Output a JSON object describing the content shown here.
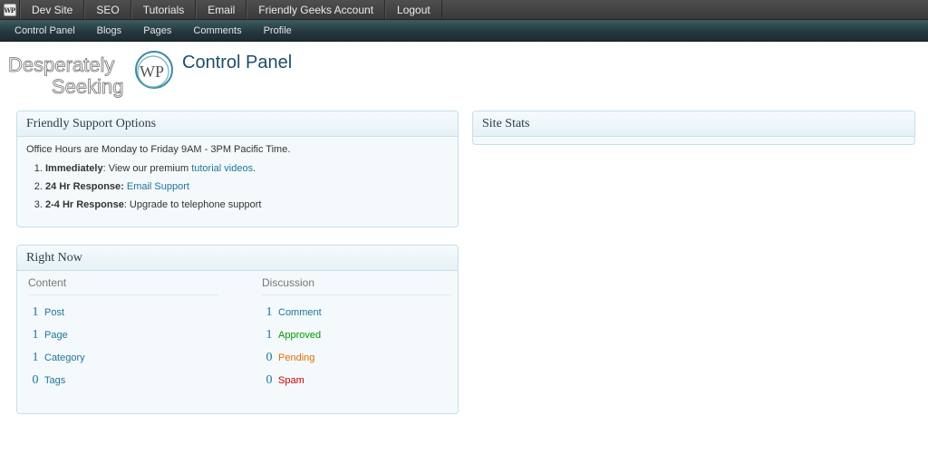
{
  "adminbar": {
    "logo_text": "WP",
    "items": [
      "Dev Site",
      "SEO",
      "Tutorials",
      "Email",
      "Friendly Geeks Account",
      "Logout"
    ]
  },
  "subnav": {
    "items": [
      "Control Panel",
      "Blogs",
      "Pages",
      "Comments",
      "Profile"
    ]
  },
  "header": {
    "logo": {
      "line1": "Desperately",
      "line2": "Seeking",
      "badge": "WP"
    },
    "title": "Control Panel"
  },
  "support": {
    "title": "Friendly Support Options",
    "hours": "Office Hours are Monday to Friday 9AM - 3PM Pacific Time.",
    "options": [
      {
        "num": "1.",
        "bold": "Immediately",
        "text": ": View our premium ",
        "link": "tutorial videos",
        "after": "."
      },
      {
        "num": "2.",
        "bold": "24 Hr Response:",
        "text": " ",
        "link": "Email Support",
        "after": ""
      },
      {
        "num": "3.",
        "bold": "2-4 Hr Response",
        "text": ": Upgrade to telephone support",
        "link": "",
        "after": ""
      }
    ]
  },
  "right_now": {
    "title": "Right Now",
    "content": {
      "heading": "Content",
      "rows": [
        {
          "count": "1",
          "label": "Post"
        },
        {
          "count": "1",
          "label": "Page"
        },
        {
          "count": "1",
          "label": "Category"
        },
        {
          "count": "0",
          "label": "Tags"
        }
      ]
    },
    "discussion": {
      "heading": "Discussion",
      "rows": [
        {
          "count": "1",
          "label": "Comment"
        },
        {
          "count": "1",
          "label": "Approved"
        },
        {
          "count": "0",
          "label": "Pending"
        },
        {
          "count": "0",
          "label": "Spam"
        }
      ]
    }
  },
  "site_stats": {
    "title": "Site Stats"
  },
  "colors": {
    "link": "#21759b",
    "approved": "#009900",
    "pending": "#e66f00",
    "spam": "#cc0000",
    "title": "#1e4e6a"
  }
}
